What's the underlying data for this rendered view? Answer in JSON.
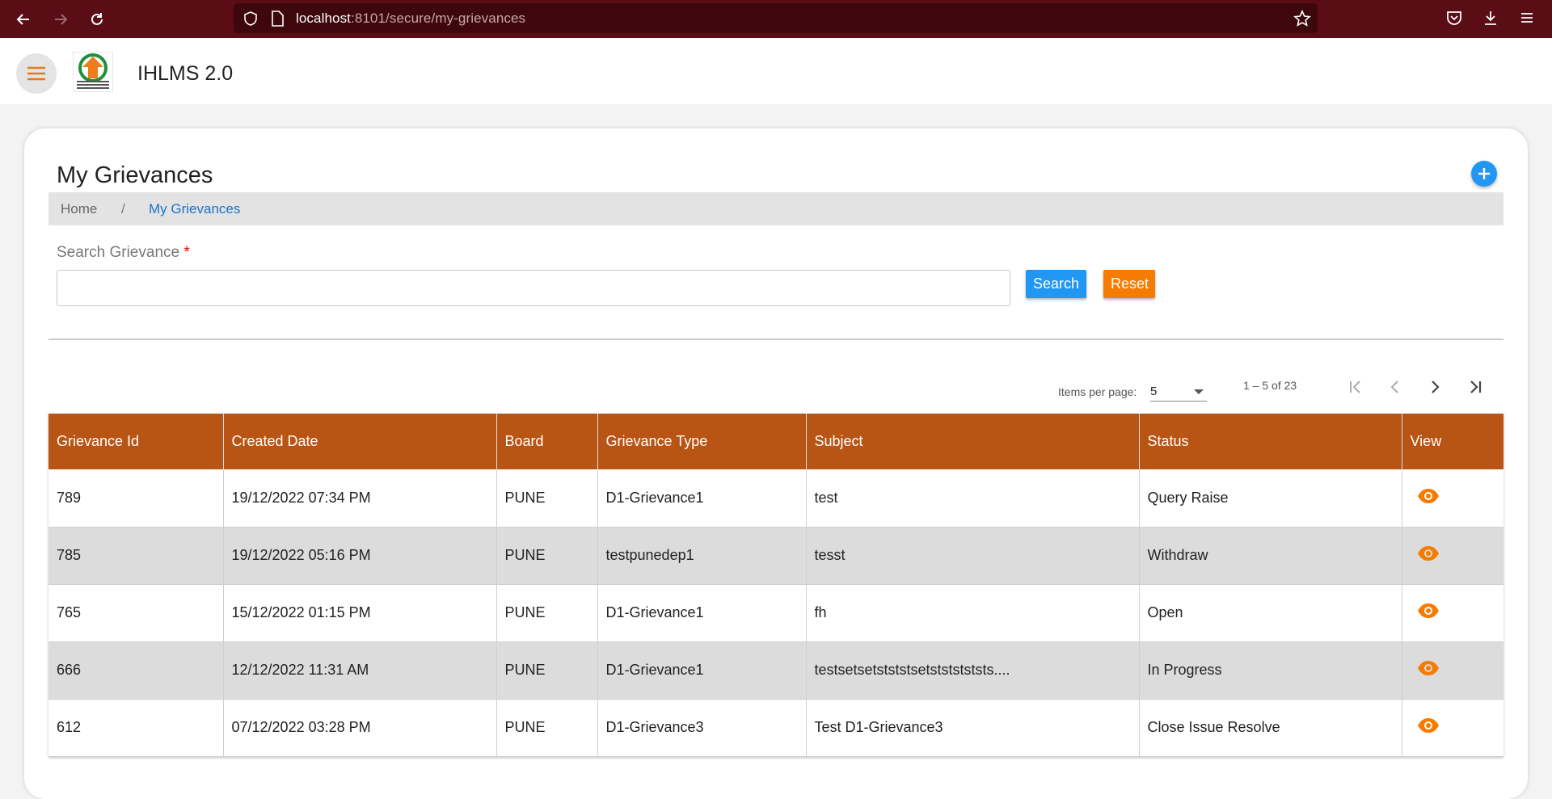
{
  "browser": {
    "url_host": "localhost",
    "url_path": ":8101/secure/my-grievances"
  },
  "app": {
    "title": "IHLMS 2.0"
  },
  "page": {
    "title": "My Grievances",
    "breadcrumb": {
      "home": "Home",
      "separator": "/",
      "current": "My Grievances"
    }
  },
  "search": {
    "label": "Search Grievance",
    "required_mark": "*",
    "value": "",
    "search_button": "Search",
    "reset_button": "Reset"
  },
  "paginator": {
    "items_per_page_label": "Items per page:",
    "items_per_page": "5",
    "range": "1 – 5 of 23"
  },
  "table": {
    "columns": [
      "Grievance Id",
      "Created Date",
      "Board",
      "Grievance Type",
      "Subject",
      "Status",
      "View"
    ],
    "rows": [
      {
        "id": "789",
        "date": "19/12/2022 07:34 PM",
        "board": "PUNE",
        "type": "D1-Grievance1",
        "subject": "test",
        "status": "Query Raise"
      },
      {
        "id": "785",
        "date": "19/12/2022 05:16 PM",
        "board": "PUNE",
        "type": "testpunedep1",
        "subject": "tesst",
        "status": "Withdraw"
      },
      {
        "id": "765",
        "date": "15/12/2022 01:15 PM",
        "board": "PUNE",
        "type": "D1-Grievance1",
        "subject": "fh",
        "status": "Open"
      },
      {
        "id": "666",
        "date": "12/12/2022 11:31 AM",
        "board": "PUNE",
        "type": "D1-Grievance1",
        "subject": "testsetsetstststsetstststststs....",
        "status": "In Progress"
      },
      {
        "id": "612",
        "date": "07/12/2022 03:28 PM",
        "board": "PUNE",
        "type": "D1-Grievance3",
        "subject": "Test D1-Grievance3",
        "status": "Close Issue Resolve"
      }
    ]
  },
  "colors": {
    "browser_bar": "#5a0d14",
    "table_header": "#b85515",
    "primary_button": "#2196f3",
    "reset_button": "#f57c00",
    "view_icon": "#f57c00"
  },
  "icons": {
    "back": "arrow-left-icon",
    "forward": "arrow-right-icon",
    "reload": "reload-icon",
    "shield": "shield-icon",
    "page": "page-icon",
    "bookmark": "star-icon",
    "pocket": "pocket-icon",
    "download": "download-icon",
    "browser_menu": "hamburger-icon",
    "app_menu": "hamburger-icon",
    "add": "plus-icon",
    "view": "eye-icon"
  }
}
